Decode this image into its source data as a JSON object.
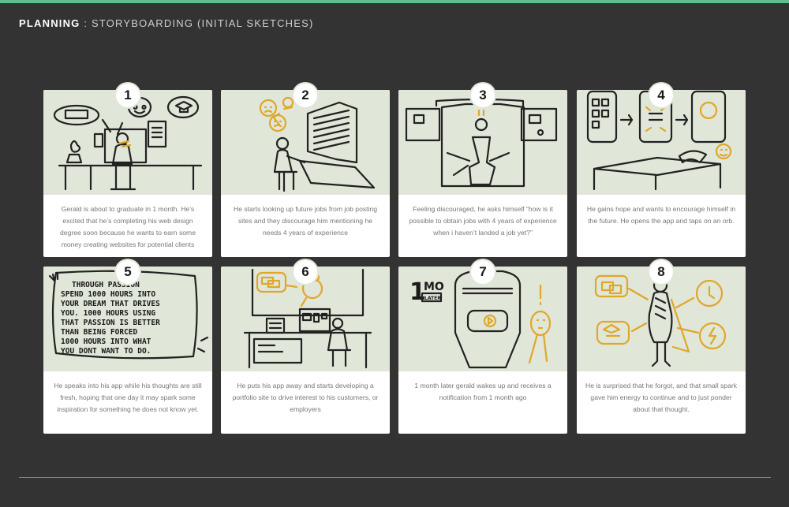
{
  "header": {
    "title_bold": "PLANNING",
    "separator": ":",
    "subtitle": "STORYBOARDING (INITIAL SKETCHES)"
  },
  "colors": {
    "accent_bar": "#5fbf8a",
    "background": "#333333",
    "sketch_bg": "#e0e6d8",
    "sketch_highlight": "#e0a72a"
  },
  "panels": [
    {
      "number": "1",
      "caption": "Gerald is about to graduate in 1 month. He’s excited that he’s completing his web design degree soon because he wants to earn some money creating websites for potential clients"
    },
    {
      "number": "2",
      "caption": "He starts looking up future jobs from job posting sites and they discourage him mentioning he needs 4 years of experience"
    },
    {
      "number": "3",
      "caption": "Feeling discouraged, he asks himself “how is it possible to obtain jobs with 4 years of experience when i haven’t landed a job yet?”"
    },
    {
      "number": "4",
      "caption": "He gains hope and wants to encourage himself in the future. He opens the app and taps on an orb."
    },
    {
      "number": "5",
      "caption": "He speaks into his app while his thoughts are still fresh, hoping that one day it may spark some inspiration for something he does not know yet.",
      "sketch_text": [
        "THROUGH PASSION",
        "SPEND 1000 HOURS INTO",
        "YOUR DREAM THAT DRIVES",
        "YOU. 1000 HOURS USING",
        "THAT PASSION IS BETTER",
        "THAN BEING FORCED",
        "1000 HOURS INTO WHAT",
        "YOU DONT WANT TO DO."
      ]
    },
    {
      "number": "6",
      "caption": "He puts his app away and starts developing a portfolio site to drive interest to his customers, or employers"
    },
    {
      "number": "7",
      "caption": "1 month later gerald wakes up and receives a notification from 1 month ago",
      "sketch_text": [
        "1",
        "MO",
        "LATER"
      ]
    },
    {
      "number": "8",
      "caption": "He is surprised that he forgot, and that small spark gave him energy to continue and to just ponder about that thought."
    }
  ]
}
